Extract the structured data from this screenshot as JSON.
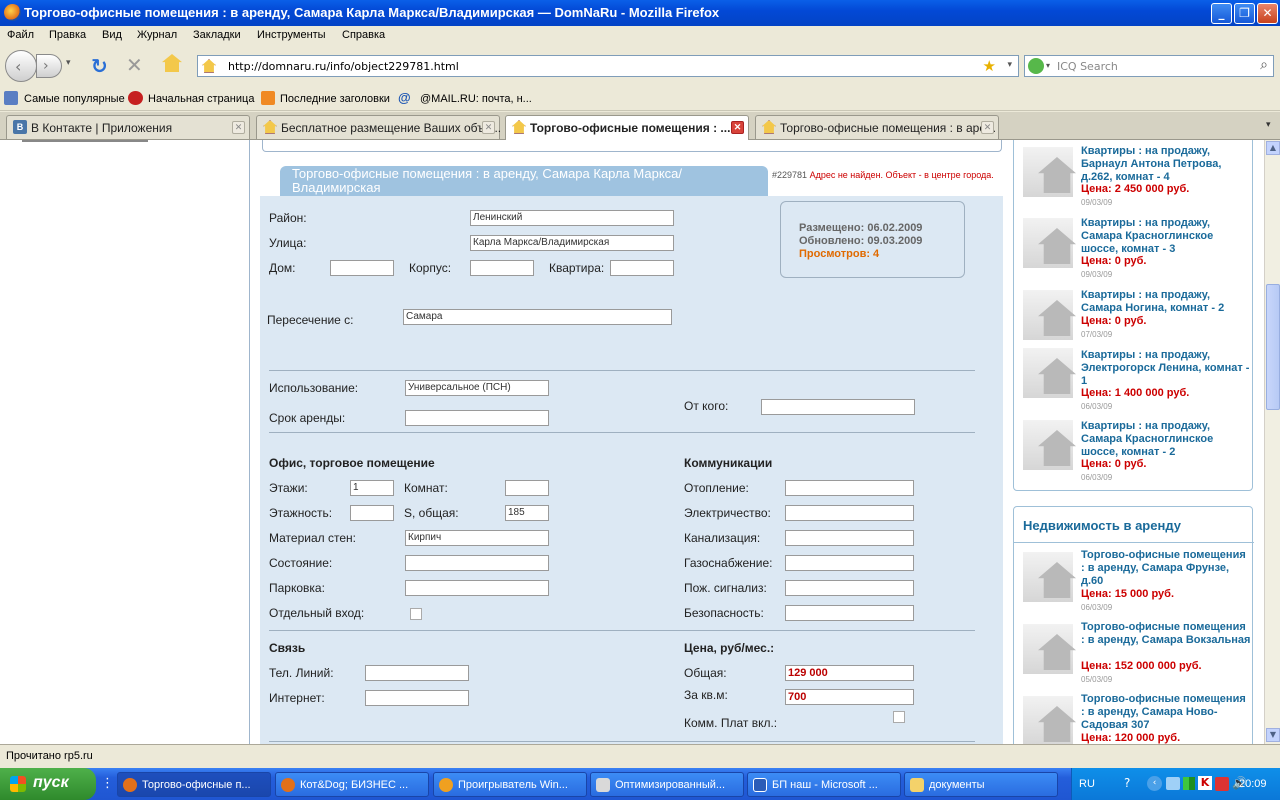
{
  "window": {
    "title": "Торгово-офисные помещения : в аренду, Самара Карла Маркса/Владимирская — DomNaRu - Mozilla Firefox"
  },
  "menu": [
    "Файл",
    "Правка",
    "Вид",
    "Журнал",
    "Закладки",
    "Инструменты",
    "Справка"
  ],
  "nav": {
    "url": "http://domnaru.ru/info/object229781.html",
    "search_placeholder": "ICQ Search"
  },
  "bookmarks": [
    "Самые популярные",
    "Начальная страница",
    "Последние заголовки",
    "@MAIL.RU: почта, н..."
  ],
  "tabs": [
    {
      "label": "В Контакте | Приложения"
    },
    {
      "label": "Бесплатное размещение Ваших объя..."
    },
    {
      "label": "Торгово-офисные помещения : ..."
    },
    {
      "label": "Торгово-офисные помещения : в аре..."
    }
  ],
  "page": {
    "header_title": "Торгово-офисные помещения : в аренду, Самара Карла Маркса/Владимирская",
    "object_id": "#229781",
    "notice": "Адрес не найден. Объект - в центре города.",
    "info": {
      "placed": "Размещено: 06.02.2009",
      "updated": "Обновлено:  09.03.2009",
      "views": "Просмотров: 4"
    },
    "address": {
      "district_label": "Район:",
      "district_value": "Ленинский",
      "street_label": "Улица:",
      "street_value": "Карла Маркса/Владимирская",
      "house_label": "Дом:",
      "korpus_label": "Корпус:",
      "flat_label": "Квартира:",
      "cross_label": "Пересечение с:",
      "cross_value": "Самара"
    },
    "usage": {
      "use_label": "Использование:",
      "use_value": "Универсальное (ПСН)",
      "term_label": "Срок аренды:",
      "from_label": "От кого:"
    },
    "office": {
      "heading": "Офис, торговое помещение",
      "floors_label": "Этажи:",
      "floors_value": "1",
      "rooms_label": "Комнат:",
      "storeys_label": "Этажность:",
      "area_label": "S, общая:",
      "area_value": "185",
      "material_label": "Материал стен:",
      "material_value": "Кирпич",
      "condition_label": "Состояние:",
      "parking_label": "Парковка:",
      "entrance_label": "Отдельный вход:"
    },
    "comm": {
      "heading": "Коммуникации",
      "heating": "Отопление:",
      "electric": "Электричество:",
      "sewer": "Канализация:",
      "gas": "Газоснабжение:",
      "fire": "Пож. сигнализ:",
      "security": "Безопасность:"
    },
    "link": {
      "heading": "Связь",
      "phones": "Тел. Линий:",
      "internet": "Интернет:"
    },
    "price": {
      "heading": "Цена, руб/мес.:",
      "total_label": "Общая:",
      "total_value": "129 000",
      "sqm_label": "За кв.м:",
      "sqm_value": "700",
      "util_label": "Комм. Плат вкл.:"
    }
  },
  "sidebar": {
    "sale_items": [
      {
        "title": "Квартиры : на продажу, Барнаул Антона Петрова, д.262, комнат - 4",
        "price": "Цена: 2 450 000 руб.",
        "date": "09/03/09"
      },
      {
        "title": "Квартиры : на продажу, Самара Красноглинское шоссе, комнат - 3",
        "price": "Цена: 0 руб.",
        "date": "09/03/09"
      },
      {
        "title": "Квартиры : на продажу, Самара Ногина, комнат - 2",
        "price": "Цена: 0 руб.",
        "date": "07/03/09"
      },
      {
        "title": "Квартиры : на продажу, Электрогорск Ленина, комнат - 1",
        "price": "Цена: 1 400 000 руб.",
        "date": "06/03/09"
      },
      {
        "title": "Квартиры : на продажу, Самара Красноглинское шоссе, комнат - 2",
        "price": "Цена: 0 руб.",
        "date": "06/03/09"
      }
    ],
    "rent_heading": "Недвижимость в аренду",
    "rent_items": [
      {
        "title": "Торгово-офисные помещения : в аренду, Самара Фрунзе, д.60",
        "price": "Цена: 15 000 руб.",
        "date": "06/03/09"
      },
      {
        "title": "Торгово-офисные помещения : в аренду, Самара Вокзальная",
        "price": "Цена: 152 000 000 руб.",
        "date": "05/03/09"
      },
      {
        "title": "Торгово-офисные помещения : в аренду, Самара Ново-Садовая 307",
        "price": "Цена: 120 000 руб.",
        "date": ""
      }
    ]
  },
  "status": {
    "text": "Прочитано rp5.ru"
  },
  "taskbar": {
    "start": "пуск",
    "buttons": [
      "Торгово-офисные п...",
      "Кот&Dog; БИЗНЕС ...",
      "Проигрыватель Win...",
      "Оптимизированный...",
      "БП наш - Microsoft ...",
      "документы"
    ],
    "lang": "RU",
    "clock": "20:09"
  },
  "colors": {
    "accent": "#1a6a9a",
    "price": "#cc0000",
    "panel": "#dce8f3",
    "header_bar": "#9fc3e0"
  }
}
